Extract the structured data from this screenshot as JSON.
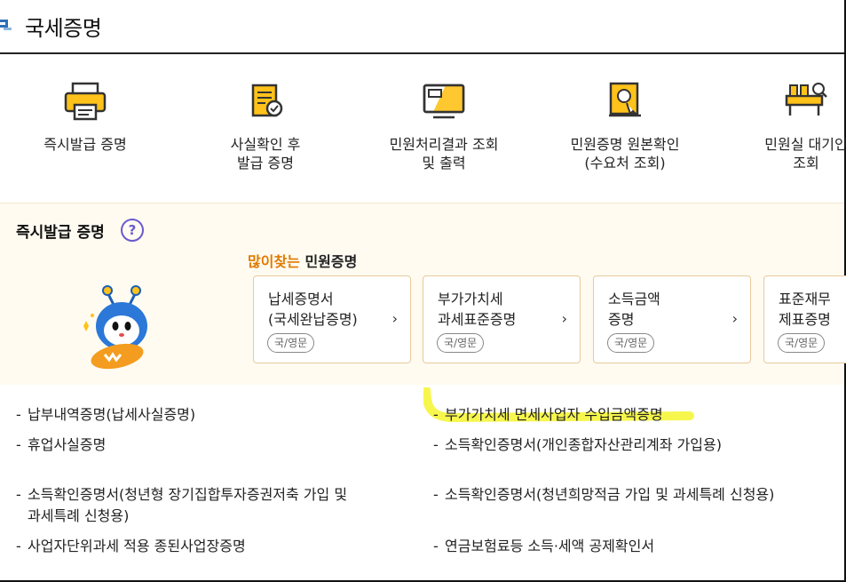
{
  "header": {
    "title": "국세증명"
  },
  "menu": [
    {
      "label": "즉시발급 증명",
      "icon": "printer-icon"
    },
    {
      "label": "사실확인 후\n발급 증명",
      "icon": "document-check-icon"
    },
    {
      "label": "민원처리결과 조회\n및 출력",
      "icon": "monitor-result-icon"
    },
    {
      "label": "민원증명 원본확인\n(수요처 조회)",
      "icon": "certificate-verify-icon"
    },
    {
      "label": "민원실 대기인\n조회",
      "icon": "waiting-room-search-icon"
    }
  ],
  "panel": {
    "title": "즉시발급 증명",
    "help": "?",
    "popular_highlight": "많이찾는",
    "popular_rest": " 민원증명"
  },
  "cards": [
    {
      "name": "납세증명서\n(국세완납증명)",
      "badge": "국/영문"
    },
    {
      "name": "부가가치세\n과세표준증명",
      "badge": "국/영문"
    },
    {
      "name": "소득금액\n증명",
      "badge": "국/영문"
    },
    {
      "name": "표준재무\n제표증명",
      "badge": "국/영문"
    }
  ],
  "list": [
    {
      "dash": "-",
      "text": "납부내역증명(납세사실증명)"
    },
    {
      "dash": "-",
      "text": "부가가치세 면세사업자 수입금액증명"
    },
    {
      "dash": "-",
      "text": "휴업사실증명"
    },
    {
      "dash": "-",
      "text": "소득확인증명서(개인종합자산관리계좌 가입용)"
    },
    {
      "dash": "-",
      "text": "소득확인증명서(청년형 장기집합투자증권저축 가입 및\n과세특례 신청용)"
    },
    {
      "dash": "-",
      "text": "소득확인증명서(청년희망적금 가입 및 과세특례 신청용)"
    },
    {
      "dash": "-",
      "text": "사업자단위과세 적용 종된사업장증명"
    },
    {
      "dash": "-",
      "text": "연금보험료등 소득·세액 공제확인서"
    }
  ],
  "colors": {
    "accent": "#ffc21a",
    "highlight_marker": "#f5f53a",
    "help": "#6a5acd",
    "popular": "#e07b00"
  }
}
